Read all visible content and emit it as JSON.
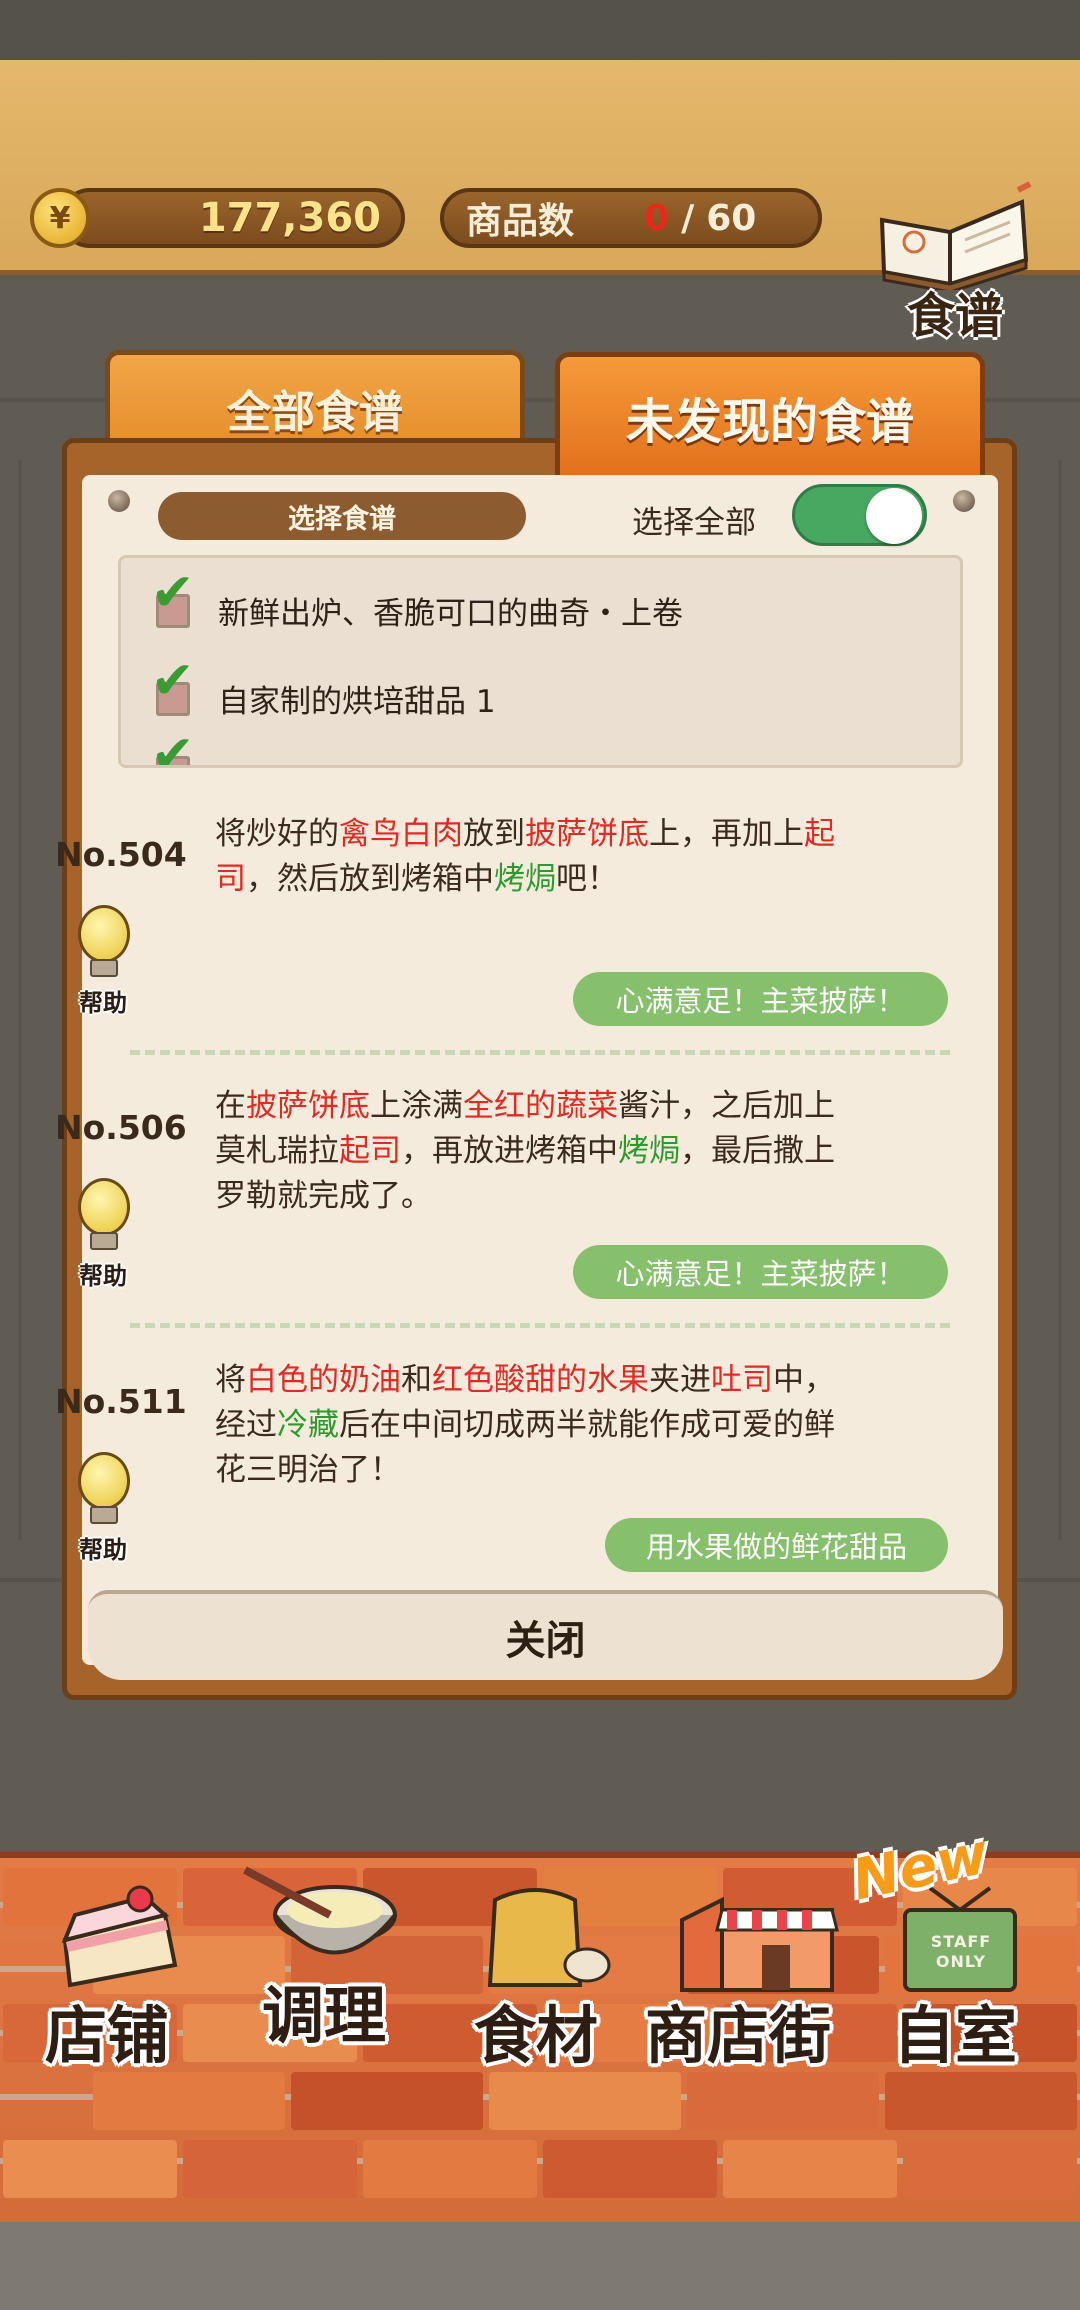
{
  "header": {
    "money": "177,360",
    "currency_symbol": "¥",
    "products_label": "商品数",
    "products_current": "0",
    "products_separator": "/",
    "products_total": "60",
    "recipe_book_label": "食谱"
  },
  "tabs": [
    {
      "label": "全部食谱",
      "active": false
    },
    {
      "label": "未发现的食谱",
      "active": true
    }
  ],
  "filter": {
    "select_recipe_label": "选择食谱",
    "select_all_label": "选择全部",
    "select_all_on": true,
    "items": [
      {
        "label": "新鲜出炉、香脆可口的曲奇・上卷",
        "checked": true
      },
      {
        "label": "自家制的烘培甜品 1",
        "checked": true
      }
    ]
  },
  "recipes": [
    {
      "number": "No.504",
      "help_label": "帮助",
      "desc_parts": [
        {
          "t": "将炒好的",
          "c": ""
        },
        {
          "t": "禽鸟白肉",
          "c": "r"
        },
        {
          "t": "放到",
          "c": ""
        },
        {
          "t": "披萨饼底",
          "c": "r"
        },
        {
          "t": "上，再加上",
          "c": ""
        },
        {
          "t": "起司",
          "c": "r"
        },
        {
          "t": "，然后放到烤箱中",
          "c": ""
        },
        {
          "t": "烤焗",
          "c": "g"
        },
        {
          "t": "吧！",
          "c": ""
        }
      ],
      "tag": "心满意足！主菜披萨！"
    },
    {
      "number": "No.506",
      "help_label": "帮助",
      "desc_parts": [
        {
          "t": "在",
          "c": ""
        },
        {
          "t": "披萨饼底",
          "c": "r"
        },
        {
          "t": "上涂满",
          "c": ""
        },
        {
          "t": "全红的蔬菜",
          "c": "r"
        },
        {
          "t": "酱汁，之后加上莫札瑞拉",
          "c": ""
        },
        {
          "t": "起司",
          "c": "r"
        },
        {
          "t": "，再放进烤箱中",
          "c": ""
        },
        {
          "t": "烤焗",
          "c": "g"
        },
        {
          "t": "，最后撒上罗勒就完成了。",
          "c": ""
        }
      ],
      "tag": "心满意足！主菜披萨！"
    },
    {
      "number": "No.511",
      "help_label": "帮助",
      "desc_parts": [
        {
          "t": "将",
          "c": ""
        },
        {
          "t": "白色的奶油",
          "c": "r"
        },
        {
          "t": "和",
          "c": ""
        },
        {
          "t": "红色酸甜的水果",
          "c": "r"
        },
        {
          "t": "夹进",
          "c": ""
        },
        {
          "t": "吐司",
          "c": "r"
        },
        {
          "t": "中，经过",
          "c": ""
        },
        {
          "t": "冷藏",
          "c": "g"
        },
        {
          "t": "后在中间切成两半就能作成可爱的鲜花三明治了！",
          "c": ""
        }
      ],
      "tag": "用水果做的鲜花甜品"
    }
  ],
  "close_label": "关闭",
  "bottom_nav": [
    {
      "label": "店铺",
      "icon": "cake-icon"
    },
    {
      "label": "调理",
      "icon": "mixing-bowl-icon"
    },
    {
      "label": "食材",
      "icon": "ingredient-bag-icon"
    },
    {
      "label": "商店街",
      "icon": "shop-building-icon"
    },
    {
      "label": "自室",
      "icon": "staff-only-door-icon",
      "badge": "New",
      "sign": "STAFF ONLY"
    }
  ],
  "colors": {
    "accent_orange": "#e48a28",
    "tag_green": "#86c06c",
    "keyword_red": "#e22a24",
    "keyword_green": "#2d9a2d"
  }
}
